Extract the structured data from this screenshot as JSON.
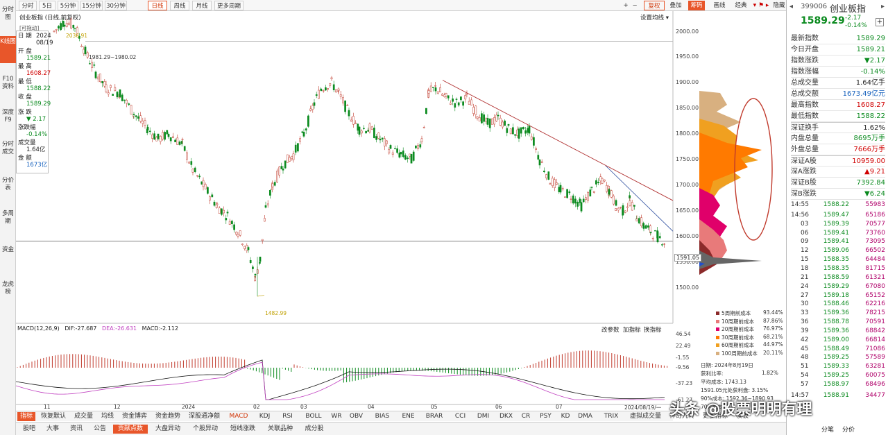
{
  "topbar": {
    "periods": [
      "分时",
      "5日",
      "5分钟",
      "15分钟",
      "30分钟",
      "日线",
      "周线",
      "月线",
      "更多周期"
    ],
    "fuquan": "复权",
    "diejia": "叠加",
    "chouma": "筹码",
    "huaxian": "画线",
    "jingdian": "经典",
    "yincang": "隐藏"
  },
  "leftnav": [
    "分时图",
    "K线图",
    "F10资料",
    "深度F9",
    "分时成交",
    "分价表",
    "多周期",
    "资金",
    "龙虎榜"
  ],
  "chart": {
    "title": "创业板指 (日线,前复权)",
    "draggable": "[可拖动]",
    "set_ma": "设置均线",
    "annot_high": "2036.91",
    "annot_range": "1981.29~1980.02",
    "annot_low": "1482.99",
    "last_price_label": "1591.05",
    "price_ticks": [
      "2000.00",
      "1950.00",
      "1900.00",
      "1850.00",
      "1800.00",
      "1750.00",
      "1700.00",
      "1650.00",
      "1600.00",
      "1550.00",
      "1500.00"
    ],
    "date_ticks": [
      "11",
      "12",
      "2024",
      "02",
      "03",
      "04",
      "05",
      "06",
      "07",
      "2024/08/19/一"
    ]
  },
  "info_panel": [
    {
      "label": "日 期",
      "value": "2024\n08/19",
      "color": "#222"
    },
    {
      "label": "开 盘",
      "value": "1589.21",
      "color": "#0a8a1e"
    },
    {
      "label": "最 高",
      "value": "1608.27",
      "color": "#d00000"
    },
    {
      "label": "最 低",
      "value": "1588.22",
      "color": "#0a8a1e"
    },
    {
      "label": "收 盘",
      "value": "1589.29",
      "color": "#0a8a1e"
    },
    {
      "label": "涨 跌",
      "value": "▼ 2.17",
      "color": "#0a8a1e"
    },
    {
      "label": "涨跌幅",
      "value": "-0.14%",
      "color": "#0a8a1e"
    },
    {
      "label": "成交量",
      "value": "1.64亿",
      "color": "#222"
    },
    {
      "label": "金 额",
      "value": "1673亿",
      "color": "#1560bd"
    }
  ],
  "macd": {
    "label": "MACD(12,26,9)",
    "dif": "DIF:-27.687",
    "dea": "DEA:-26.631",
    "macd": "MACD:-2.112",
    "btn1": "改参数",
    "btn2": "加指标",
    "btn3": "换指标",
    "ticks": [
      "46.54",
      "22.49",
      "-1.55",
      "-9.56",
      "-37.23",
      "-61.27"
    ]
  },
  "chip_legend": {
    "rows": [
      {
        "label": "5周期前成本",
        "value": "93.44%",
        "color": "#8b2a2a"
      },
      {
        "label": "10周期前成本",
        "value": "87.86%",
        "color": "#e87a7a"
      },
      {
        "label": "20周期前成本",
        "value": "76.97%",
        "color": "#e0006a"
      },
      {
        "label": "30周期前成本",
        "value": "68.21%",
        "color": "#ff7a00"
      },
      {
        "label": "60周期前成本",
        "value": "44.97%",
        "color": "#f0a020"
      },
      {
        "label": "100周期前成本",
        "value": "20.11%",
        "color": "#d8b080"
      }
    ],
    "date": "日期: 2024年8月19日",
    "profit": "获利比率:",
    "profit_val": "1.82%",
    "avg_cost": "平均成本: 1743.13",
    "cost_line": "1591.05元处获利盘: 3.15%",
    "range": "90%成本: 1592.36~1890.93",
    "conc": "70%成本"
  },
  "right": {
    "code": "399006",
    "name": "创业板指",
    "price": "1589.29",
    "chg": "-2.17",
    "pct": "-0.14%",
    "rows": [
      {
        "label": "最新指数",
        "value": "1589.29",
        "color": "#0a8a1e"
      },
      {
        "label": "今日开盘",
        "value": "1589.21",
        "color": "#0a8a1e"
      },
      {
        "label": "指数涨跌",
        "value": "▼2.17",
        "color": "#0a8a1e"
      },
      {
        "label": "指数涨幅",
        "value": "-0.14%",
        "color": "#0a8a1e"
      },
      {
        "label": "总成交量",
        "value": "1.64亿手",
        "color": "#222"
      },
      {
        "label": "总成交额",
        "value": "1673.49亿元",
        "color": "#1560bd"
      },
      {
        "label": "最高指数",
        "value": "1608.27",
        "color": "#d00000"
      },
      {
        "label": "最低指数",
        "value": "1588.22",
        "color": "#0a8a1e"
      },
      {
        "label": "深证换手",
        "value": "1.62%",
        "color": "#222"
      },
      {
        "label": "内盘总量",
        "value": "8695万手",
        "color": "#0a8a1e"
      },
      {
        "label": "外盘总量",
        "value": "7666万手",
        "color": "#d00000"
      },
      {
        "label": "深证A股",
        "value": "10959.00",
        "color": "#d00000"
      },
      {
        "label": "深A涨跌",
        "value": "▲9.21",
        "color": "#d00000"
      },
      {
        "label": "深证B股",
        "value": "7392.84",
        "color": "#0a8a1e"
      },
      {
        "label": "深B涨跌",
        "value": "▼6.24",
        "color": "#0a8a1e"
      }
    ],
    "ticks": [
      [
        "14:55",
        "1588.22",
        "55983"
      ],
      [
        "14:56",
        "1589.47",
        "65186"
      ],
      [
        "03",
        "1589.39",
        "70577"
      ],
      [
        "06",
        "1589.41",
        "73760"
      ],
      [
        "09",
        "1589.41",
        "73095"
      ],
      [
        "12",
        "1589.06",
        "66502"
      ],
      [
        "15",
        "1588.35",
        "64484"
      ],
      [
        "18",
        "1588.35",
        "81715"
      ],
      [
        "21",
        "1588.59",
        "61321"
      ],
      [
        "24",
        "1589.29",
        "67080"
      ],
      [
        "27",
        "1589.18",
        "65152"
      ],
      [
        "30",
        "1588.46",
        "62216"
      ],
      [
        "33",
        "1589.36",
        "78215"
      ],
      [
        "36",
        "1588.78",
        "70591"
      ],
      [
        "39",
        "1589.36",
        "68842"
      ],
      [
        "42",
        "1589.00",
        "66814"
      ],
      [
        "45",
        "1588.49",
        "71086"
      ],
      [
        "48",
        "1589.25",
        "57589"
      ],
      [
        "51",
        "1589.33",
        "63281"
      ],
      [
        "54",
        "1589.25",
        "60075"
      ],
      [
        "57",
        "1588.97",
        "68496"
      ],
      [
        "14:57",
        "1588.91",
        "34477"
      ]
    ],
    "bottom": [
      "分笔",
      "分价"
    ]
  },
  "tabs1": [
    "指标",
    "恢复默认",
    "成交量",
    "均线",
    "资金博弈",
    "资金趋势",
    "深股通净额",
    "MACD",
    "KDJ",
    "RSI",
    "BOLL",
    "WR",
    "OBV",
    "BIAS",
    "ENE",
    "BRAR",
    "CCI",
    "DMI",
    "DKX",
    "CR",
    "PSY",
    "KD",
    "DMA",
    "TRIX",
    "虚拟成交量",
    "神奇九转",
    "更多指标",
    "模板"
  ],
  "tabs2": [
    "股吧",
    "大事",
    "资讯",
    "公告",
    "贡献点数",
    "大盘异动",
    "个股异动",
    "短线涨跌",
    "关联品种",
    "成分股"
  ],
  "watermark": "头条 @股票明明有理",
  "colors": {
    "up": "#d00000",
    "down": "#0a8a1e",
    "accent": "#e8562a"
  }
}
